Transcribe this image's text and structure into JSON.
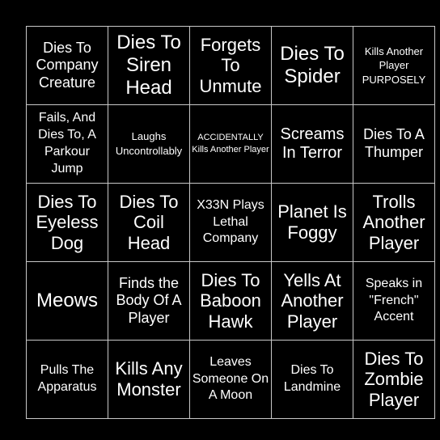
{
  "board": {
    "rows": [
      [
        "Dies To Company Creature",
        "Dies To Siren Head",
        "Forgets To Unmute",
        "Dies To Spider",
        "Kills Another Player PURPOSELY"
      ],
      [
        "Fails, And Dies To, A Parkour Jump",
        "Laughs Uncontrollably",
        "ACCIDENTALLY Kills Another Player",
        "Screams In Terror",
        "Dies To A Thumper"
      ],
      [
        "Dies To Eyeless Dog",
        "Dies To Coil Head",
        "X33N Plays Lethal Company",
        "Planet Is Foggy",
        "Trolls Another Player"
      ],
      [
        "Meows",
        "Finds the Body Of A Player",
        "Dies To Baboon Hawk",
        "Yells At Another Player",
        "Speaks in \"French\" Accent"
      ],
      [
        "Pulls The Apparatus",
        "Kills Any Monster",
        "Leaves Someone On A Moon",
        "Dies To Landmine",
        "Dies To Zombie Player"
      ]
    ]
  },
  "colors": {
    "background": "#000000",
    "grid_line": "#c8c8c8",
    "text": "#ffffff"
  }
}
